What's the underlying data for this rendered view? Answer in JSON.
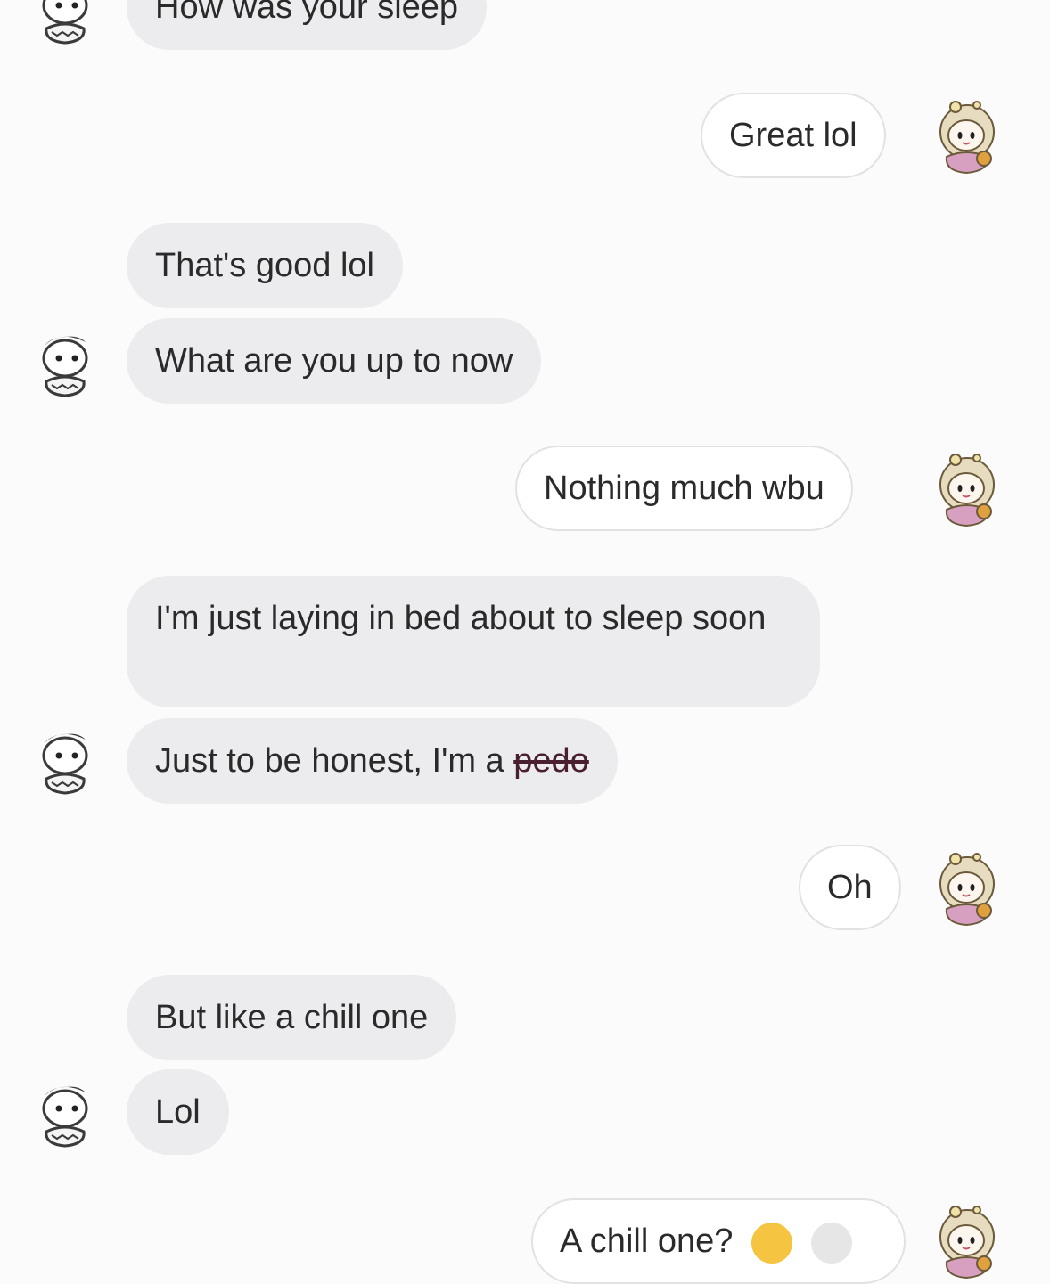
{
  "messages": [
    {
      "side": "in",
      "text": "How was your sleep"
    },
    {
      "side": "out",
      "text": "Great lol"
    },
    {
      "side": "in",
      "text": "That's good lol"
    },
    {
      "side": "in",
      "text": "What are you up to now"
    },
    {
      "side": "out",
      "text": "Nothing much wbu"
    },
    {
      "side": "in",
      "text": "I'm just laying in bed about to sleep soon"
    },
    {
      "side": "in",
      "text_before": "Just to be honest, I'm a ",
      "text_struck": "pedo"
    },
    {
      "side": "out",
      "text": "Oh"
    },
    {
      "side": "in",
      "text": "But like a chill one"
    },
    {
      "side": "in",
      "text": "Lol"
    },
    {
      "side": "out",
      "text": "A chill one?"
    }
  ],
  "icons": {
    "incoming_avatar": "cartoon-boy-avatar-icon",
    "outgoing_avatar": "cartoon-girl-avatar-icon",
    "emoji": "crying-laughing-emoji-icon"
  },
  "colors": {
    "incoming_bubble": "#ececef",
    "outgoing_bubble": "#ffffff",
    "background": "#fbfbfb"
  }
}
